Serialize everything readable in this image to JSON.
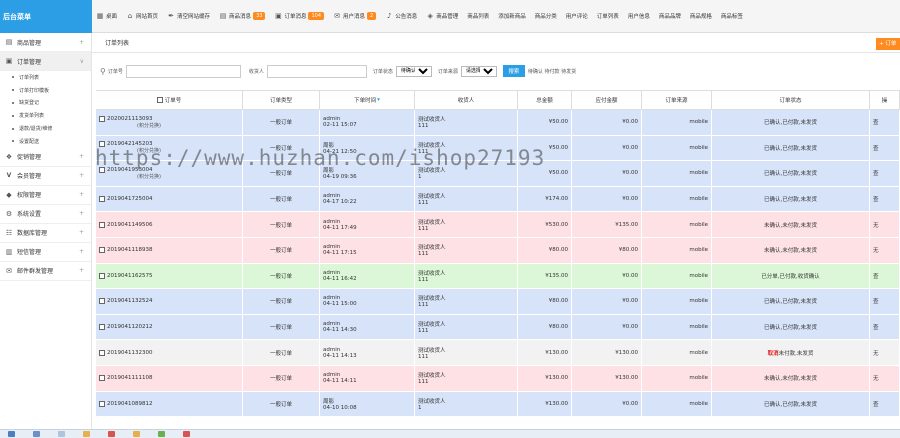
{
  "app": {
    "title": "后台菜单"
  },
  "topnav": [
    {
      "icon": "grid-icon",
      "label": "桌面"
    },
    {
      "icon": "home-icon",
      "label": "网站首页"
    },
    {
      "icon": "brush-icon",
      "label": "清空网站缓存"
    },
    {
      "icon": "doc-icon",
      "label": "商品消息",
      "badge": "33",
      "badge_color": "#ff8a1f"
    },
    {
      "icon": "cart-icon",
      "label": "订单消息",
      "badge": "104",
      "badge_color": "#ff8a1f"
    },
    {
      "icon": "chat-icon",
      "label": "用户消息",
      "badge": "2",
      "badge_color": "#ff8a1f"
    },
    {
      "icon": "bell-icon",
      "label": "公告消息"
    },
    {
      "icon": "tag-icon",
      "label": "商品管理"
    },
    {
      "label": "商品列表"
    },
    {
      "label": "添加新商品"
    },
    {
      "label": "商品分类"
    },
    {
      "label": "用户评论"
    },
    {
      "label": "订单列表"
    },
    {
      "label": "用户信息"
    },
    {
      "label": "商品品牌"
    },
    {
      "label": "商品规格"
    },
    {
      "label": "商品标签"
    }
  ],
  "sidebar": {
    "sections": [
      {
        "icon": "box-icon",
        "label": "商品管理",
        "open": false,
        "items": []
      },
      {
        "icon": "cart-icon",
        "label": "订单管理",
        "open": true,
        "items": [
          "订单列表",
          "订单打印模板",
          "缺货登记",
          "发货单列表",
          "退款/退货/维修",
          "设置配送"
        ]
      },
      {
        "icon": "gift-icon",
        "label": "促销管理",
        "open": false,
        "items": []
      },
      {
        "icon": "vip-icon",
        "label": "会员管理",
        "open": false,
        "items": []
      },
      {
        "icon": "shield-icon",
        "label": "权限管理",
        "open": false,
        "items": []
      },
      {
        "icon": "gear-icon",
        "label": "系统设置",
        "open": false,
        "items": []
      },
      {
        "icon": "db-icon",
        "label": "数据库管理",
        "open": false,
        "items": []
      },
      {
        "icon": "sms-icon",
        "label": "短信管理",
        "open": false,
        "items": []
      },
      {
        "icon": "mail-icon",
        "label": "邮件群发管理",
        "open": false,
        "items": []
      }
    ]
  },
  "page": {
    "title": "订单列表",
    "add_label": "+ 订单"
  },
  "filters": {
    "order_no_label": "订单号",
    "consignee_label": "收货人",
    "status_label": "订单状态",
    "status_value": "待确认",
    "source_label": "订单来源",
    "source_value": "请选择...",
    "search_label": "搜索",
    "quick_links": "待确认 待付款 待发货"
  },
  "columns": [
    "订单号",
    "订单类型",
    "下单时间",
    "收货人",
    "总金额",
    "应付金额",
    "订单来源",
    "订单状态",
    "操"
  ],
  "orders": [
    {
      "no": "2020021113093",
      "note": "(积分兑换)",
      "type": "一般订单",
      "user": "admin",
      "time": "02-11 15:07",
      "consignee": "测试收货人",
      "tel": "111",
      "total": "¥50.00",
      "payable": "¥0.00",
      "source": "mobile",
      "status": "已确认,已付款,未发货",
      "status_red": "",
      "op": "查",
      "bg": "bg-blue"
    },
    {
      "no": "2019042145203",
      "note": "(积分兑换)",
      "type": "一般订单",
      "user": "周影",
      "time": "04-21 12:50",
      "consignee": "测试收货人",
      "tel": "111",
      "total": "¥50.00",
      "payable": "¥0.00",
      "source": "mobile",
      "status": "已确认,已付款,未发货",
      "status_red": "",
      "op": "查",
      "bg": "bg-blue"
    },
    {
      "no": "2019041953004",
      "note": "(积分兑换)",
      "type": "一般订单",
      "user": "周影",
      "time": "04-19 09:36",
      "consignee": "测试收货人",
      "tel": "1",
      "total": "¥50.00",
      "payable": "¥0.00",
      "source": "mobile",
      "status": "已确认,已付款,未发货",
      "status_red": "",
      "op": "查",
      "bg": "bg-blue"
    },
    {
      "no": "2019041725004",
      "note": "",
      "type": "一般订单",
      "user": "admin",
      "time": "04-17 10:22",
      "consignee": "测试收货人",
      "tel": "111",
      "total": "¥174.00",
      "payable": "¥0.00",
      "source": "mobile",
      "status": "已确认,已付款,未发货",
      "status_red": "",
      "op": "查",
      "bg": "bg-blue"
    },
    {
      "no": "2019041149506",
      "note": "",
      "type": "一般订单",
      "user": "admin",
      "time": "04-11 17:49",
      "consignee": "测试收货人",
      "tel": "111",
      "total": "¥530.00",
      "payable": "¥135.00",
      "source": "mobile",
      "status": "未确认,未付款,未发货",
      "status_red": "",
      "op": "无",
      "bg": "bg-pink"
    },
    {
      "no": "2019041118938",
      "note": "",
      "type": "一般订单",
      "user": "admin",
      "time": "04-11 17:15",
      "consignee": "测试收货人",
      "tel": "111",
      "total": "¥80.00",
      "payable": "¥80.00",
      "source": "mobile",
      "status": "未确认,未付款,未发货",
      "status_red": "",
      "op": "无",
      "bg": "bg-pink"
    },
    {
      "no": "2019041162575",
      "note": "",
      "type": "一般订单",
      "user": "admin",
      "time": "04-11 16:42",
      "consignee": "测试收货人",
      "tel": "111",
      "total": "¥135.00",
      "payable": "¥0.00",
      "source": "mobile",
      "status": "已分单,已付款,收货确认",
      "status_red": "",
      "op": "查",
      "bg": "bg-green"
    },
    {
      "no": "2019041132524",
      "note": "",
      "type": "一般订单",
      "user": "admin",
      "time": "04-11 15:00",
      "consignee": "测试收货人",
      "tel": "111",
      "total": "¥80.00",
      "payable": "¥0.00",
      "source": "mobile",
      "status": "已确认,已付款,未发货",
      "status_red": "",
      "op": "查",
      "bg": "bg-blue"
    },
    {
      "no": "2019041120212",
      "note": "",
      "type": "一般订单",
      "user": "admin",
      "time": "04-11 14:30",
      "consignee": "测试收货人",
      "tel": "111",
      "total": "¥80.00",
      "payable": "¥0.00",
      "source": "mobile",
      "status": "已确认,已付款,未发货",
      "status_red": "",
      "op": "查",
      "bg": "bg-blue"
    },
    {
      "no": "2019041132300",
      "note": "",
      "type": "一般订单",
      "user": "admin",
      "time": "04-11 14:13",
      "consignee": "测试收货人",
      "tel": "111",
      "total": "¥130.00",
      "payable": "¥130.00",
      "source": "mobile",
      "status": "未付款,未发货",
      "status_red": "取消",
      "op": "无",
      "bg": "bg-gray"
    },
    {
      "no": "2019041111108",
      "note": "",
      "type": "一般订单",
      "user": "admin",
      "time": "04-11 14:11",
      "consignee": "测试收货人",
      "tel": "111",
      "total": "¥130.00",
      "payable": "¥130.00",
      "source": "mobile",
      "status": "未确认,未付款,未发货",
      "status_red": "",
      "op": "无",
      "bg": "bg-pink"
    },
    {
      "no": "2019041089812",
      "note": "",
      "type": "一般订单",
      "user": "周影",
      "time": "04-10 10:08",
      "consignee": "测试收货人",
      "tel": "1",
      "total": "¥130.00",
      "payable": "¥0.00",
      "source": "mobile",
      "status": "已确认,已付款,未发货",
      "status_red": "",
      "op": "查",
      "bg": "bg-blue"
    }
  ],
  "watermark": "https://www.huzhan.com/ishop27193",
  "taskbar_colors": [
    "#4a7fc1",
    "#6a8fc9",
    "#b0c4de",
    "#e8b04a",
    "#d9534f",
    "#e8b04a",
    "#6ab04c",
    "#d9534f"
  ]
}
